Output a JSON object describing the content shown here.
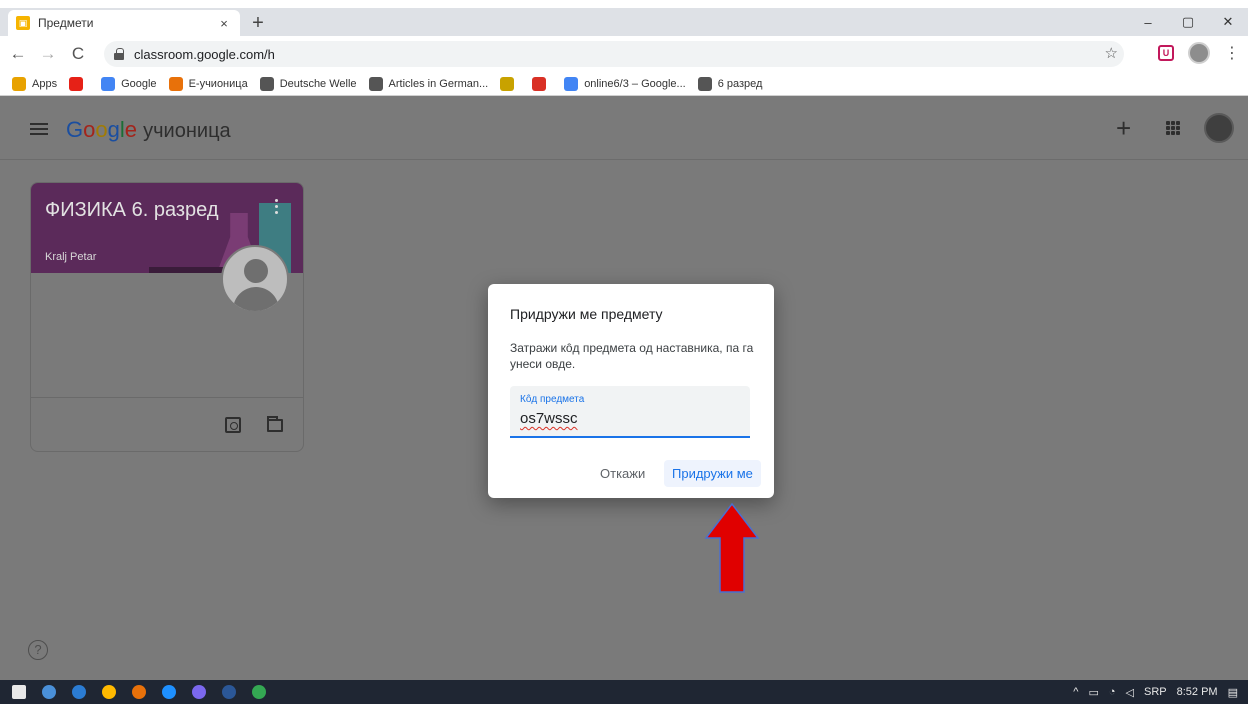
{
  "browser": {
    "tab_title": "Предмети",
    "tab_close": "×",
    "new_tab": "+",
    "window_controls": [
      "–",
      "▢",
      "✕"
    ],
    "nav": {
      "back": "←",
      "forward": "→",
      "reload": "C"
    },
    "url": "classroom.google.com/h",
    "bookmarks": [
      {
        "label": "Apps",
        "color": "#e8a200"
      },
      {
        "label": "",
        "color": "#e62117"
      },
      {
        "label": "Google",
        "color": "#4285f4"
      },
      {
        "label": "E-учионица",
        "color": "#e8710a"
      },
      {
        "label": "Deutsche Welle",
        "color": "#555555"
      },
      {
        "label": "Articles in German...",
        "color": "#555555"
      },
      {
        "label": "",
        "color": "#c8a200"
      },
      {
        "label": "",
        "color": "#d93025"
      },
      {
        "label": "online6/3 – Google...",
        "color": "#4285f4"
      },
      {
        "label": "6 разред",
        "color": "#555555"
      }
    ]
  },
  "app": {
    "logo_letters": [
      "G",
      "o",
      "o",
      "g",
      "l",
      "e"
    ],
    "app_name": "учионица",
    "add_icon": "+"
  },
  "class_card": {
    "title": "ФИЗИКА 6. разред",
    "teacher": "Kralj Petar"
  },
  "dialog": {
    "title": "Придружи ме предмету",
    "description": "Затражи кôд предмета од наставника, па га унеси овде.",
    "field_label": "Кôд предмета",
    "field_value": "os7wssc",
    "cancel_label": "Откажи",
    "join_label": "Придружи ме"
  },
  "help_icon": "?",
  "taskbar": {
    "app_colors": [
      "#4a90d9",
      "#2b7cd3",
      "#ffb900",
      "#e8710a",
      "#1e90ff",
      "#7b68ee",
      "#2b5797",
      "#34a853"
    ],
    "tray": {
      "caret": "^",
      "language": "SRP",
      "time": "8:52 PM"
    }
  },
  "colors": {
    "accent": "#1a73e8",
    "annotation_arrow": "#e00000"
  }
}
